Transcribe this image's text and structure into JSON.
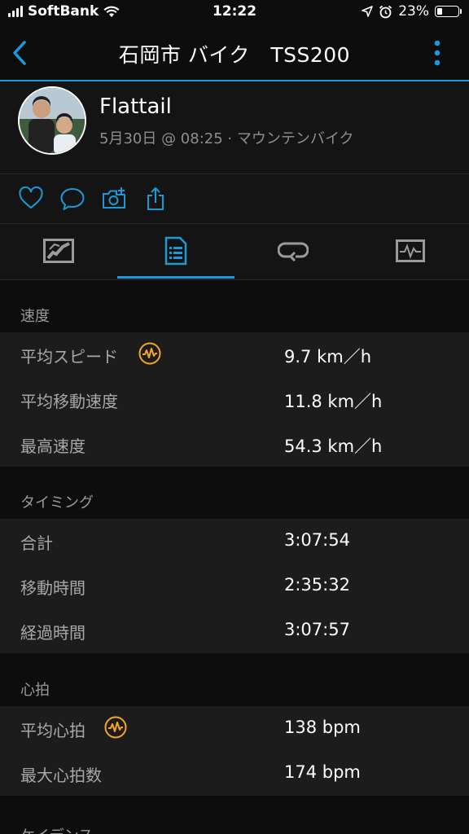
{
  "status_bar": {
    "carrier": "SoftBank",
    "time": "12:22",
    "battery": "23%",
    "battery_level": 0.23
  },
  "header": {
    "title": "石岡市 バイク　TSS200"
  },
  "profile": {
    "name": "Flattail",
    "meta": "5月30日 @ 08:25 · マウンテンバイク"
  },
  "actions": [
    "heart-icon",
    "comment-icon",
    "add-photo-icon",
    "share-icon"
  ],
  "tabs": [
    {
      "icon": "map-icon",
      "selected": false
    },
    {
      "icon": "stats-list-icon",
      "selected": true
    },
    {
      "icon": "laps-icon",
      "selected": false
    },
    {
      "icon": "charts-icon",
      "selected": false
    }
  ],
  "sections": {
    "speed": {
      "title": "速度",
      "rows": [
        {
          "label": "平均スピード",
          "value": "9.7 km／h"
        },
        {
          "label": "平均移動速度",
          "value": "11.8 km／h"
        },
        {
          "label": "最高速度",
          "value": "54.3 km／h"
        }
      ]
    },
    "timing": {
      "title": "タイミング",
      "rows": [
        {
          "label": "合計",
          "value": "3:07:54"
        },
        {
          "label": "移動時間",
          "value": "2:35:32"
        },
        {
          "label": "経過時間",
          "value": "3:07:57"
        }
      ]
    },
    "heart": {
      "title": "心拍",
      "rows": [
        {
          "label": "平均心拍",
          "value": "138 bpm"
        },
        {
          "label": "最大心拍数",
          "value": "174 bpm"
        }
      ]
    },
    "cadence": {
      "title": "ケイデンス"
    }
  },
  "colors": {
    "accent": "#1a9ad6",
    "badge": "#f5a623",
    "background": "#0d0d0d",
    "row_bg": "#1c1c1c"
  }
}
